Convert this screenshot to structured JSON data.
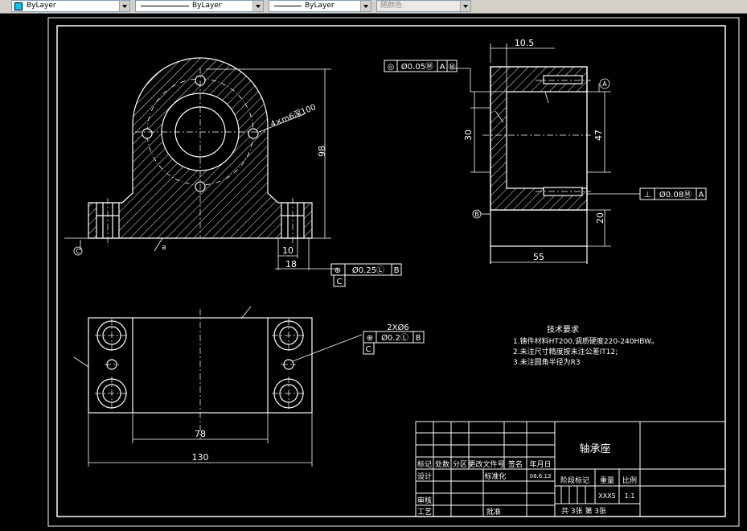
{
  "toolbar": {
    "color_control": "ByLayer",
    "linetype_control": "ByLayer",
    "lineweight_control": "ByLayer",
    "plotstyle_control": "随颜色",
    "accent_color": "#00c8ff"
  },
  "drawing": {
    "front_view": {
      "dim_98": "98",
      "dim_10": "10",
      "dim_18": "18",
      "hole_callout": "4×m6深100",
      "roughness_label": "a",
      "datum_c": "C",
      "tol_symbol": "⊕",
      "tol_value": "Ø0.25Ⓛ",
      "tol_datum": "B",
      "tol_datum_c": "C"
    },
    "side_view": {
      "dim_10_5": "10.5",
      "dim_30": "30",
      "dim_47": "47",
      "dim_20": "20",
      "dim_55": "55",
      "datum_a": "A",
      "datum_b": "B",
      "top_frame_symbol": "◎",
      "top_frame_value": "Ø0.05Ⓜ",
      "top_frame_datum": "A",
      "top_frame_datum2": "Ⓜ",
      "bottom_frame_symbol": "⊥",
      "bottom_frame_value": "Ø0.08Ⓜ",
      "bottom_frame_datum": "A"
    },
    "top_view": {
      "dim_78": "78",
      "dim_130": "130",
      "hole_label": "2XØ6",
      "tol_symbol": "⊕",
      "tol_value": "Ø0.2Ⓛ",
      "tol_datum": "B",
      "tol_datum_c": "C"
    },
    "tech_requirements": {
      "title": "技术要求",
      "line1": "1.铸件材料HT200,调质硬度220-240HBW。",
      "line2": "2.未注尺寸精度按未注公差IT12;",
      "line3": "3.未注圆角半径为R3"
    },
    "title_block": {
      "part_name": "轴承座",
      "h_mark": "标记",
      "h_count": "处数",
      "h_zone": "分区",
      "h_doc": "更改文件号",
      "h_sign": "签名",
      "h_date": "年月日",
      "design": "设计",
      "standardize": "标准化",
      "date_value": "08.6.13",
      "stage_mark": "阶段标记",
      "weight": "重量",
      "scale": "比例",
      "weight_value": "XXX5",
      "scale_value": "1:1",
      "review": "审核",
      "process": "工艺",
      "approve": "批准",
      "sheets": "共  3张 第 3张"
    }
  }
}
